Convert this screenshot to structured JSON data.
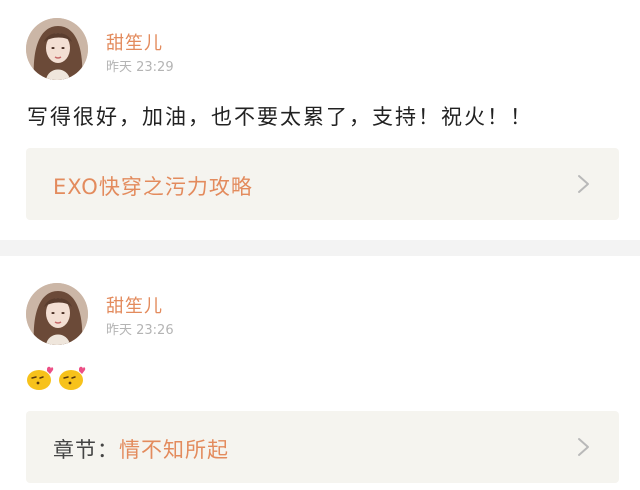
{
  "comments": [
    {
      "user_name": "甜笙儿",
      "timestamp": "昨天 23:29",
      "text": "写得很好，加油，也不要太累了，支持！祝火！！",
      "reference": {
        "label": "",
        "link_text": "EXO快穿之污力攻略",
        "icon": "chevron-right-icon"
      }
    },
    {
      "user_name": "甜笙儿",
      "timestamp": "昨天 23:26",
      "emojis": [
        "kiss-emoji",
        "kiss-emoji"
      ],
      "reference": {
        "label": "章节：",
        "link_text": "情不知所起",
        "icon": "chevron-right-icon"
      }
    }
  ],
  "colors": {
    "accent": "#e38b5d",
    "timestamp": "#b4b4b4",
    "reference_bg": "#f5f4ef",
    "divider": "#f3f3f3"
  }
}
